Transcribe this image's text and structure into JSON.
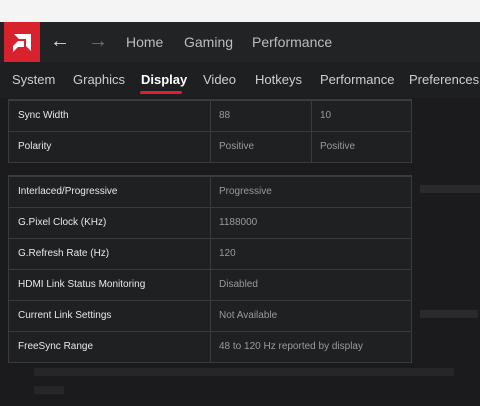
{
  "header": {
    "logo_icon": "amd-logo",
    "back_icon": "back-arrow-icon",
    "forward_icon": "forward-arrow-icon",
    "nav": [
      "Home",
      "Gaming",
      "Performance"
    ]
  },
  "tabs": [
    {
      "label": "System",
      "active": false
    },
    {
      "label": "Graphics",
      "active": false
    },
    {
      "label": "Display",
      "active": true
    },
    {
      "label": "Video",
      "active": false
    },
    {
      "label": "Hotkeys",
      "active": false
    },
    {
      "label": "Performance",
      "active": false
    },
    {
      "label": "Preferences",
      "active": false
    }
  ],
  "colors": {
    "accent": "#d8232f",
    "underline": "#e01e2e"
  },
  "table_top": {
    "rows": [
      {
        "label": "Sync Width",
        "v1": "88",
        "v2": "10"
      },
      {
        "label": "Polarity",
        "v1": "Positive",
        "v2": "Positive"
      }
    ]
  },
  "table_main": {
    "rows": [
      {
        "label": "Interlaced/Progressive",
        "value": "Progressive"
      },
      {
        "label": "G.Pixel Clock (KHz)",
        "value": "1188000"
      },
      {
        "label": "G.Refresh Rate (Hz)",
        "value": "120"
      },
      {
        "label": "HDMI Link Status Monitoring",
        "value": "Disabled"
      },
      {
        "label": "Current Link Settings",
        "value": "Not Available"
      },
      {
        "label": "FreeSync Range",
        "value": "48 to 120 Hz reported by display"
      }
    ]
  }
}
